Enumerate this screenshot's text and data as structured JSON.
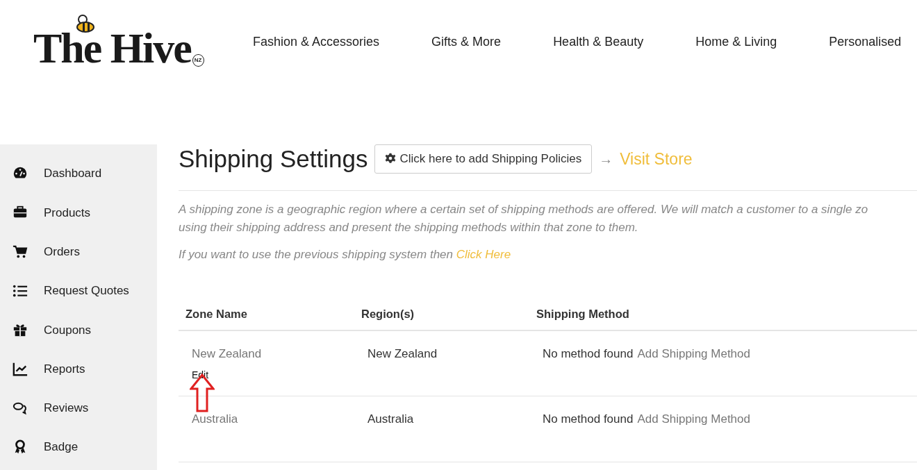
{
  "logo": {
    "text": "The Hive",
    "badge": "NZ"
  },
  "nav": [
    "Fashion & Accessories",
    "Gifts & More",
    "Health & Beauty",
    "Home & Living",
    "Personalised"
  ],
  "sidebar": {
    "items": [
      {
        "label": "Dashboard"
      },
      {
        "label": "Products"
      },
      {
        "label": "Orders"
      },
      {
        "label": "Request Quotes"
      },
      {
        "label": "Coupons"
      },
      {
        "label": "Reports"
      },
      {
        "label": "Reviews"
      },
      {
        "label": "Badge"
      }
    ]
  },
  "page": {
    "title": "Shipping Settings",
    "policies_button": "Click here to add Shipping Policies",
    "arrow": "→",
    "visit_store": "Visit Store",
    "description_lines": [
      "A shipping zone is a geographic region where a certain set of shipping methods are offered. We will match a customer to a single zo",
      "using their shipping address and present the shipping methods within that zone to them."
    ],
    "previous_text": "If you want to use the previous shipping system then",
    "previous_link": "Click Here"
  },
  "table": {
    "columns": [
      "Zone Name",
      "Region(s)",
      "Shipping Method"
    ],
    "rows": [
      {
        "zone": "New Zealand",
        "edit": "Edit",
        "region": "New Zealand",
        "method": "No method found",
        "add": "Add Shipping Method"
      },
      {
        "zone": "Australia",
        "region": "Australia",
        "method": "No method found",
        "add": "Add Shipping Method"
      }
    ]
  },
  "annotation": {
    "kind": "up-arrow",
    "color": "#e02020"
  }
}
